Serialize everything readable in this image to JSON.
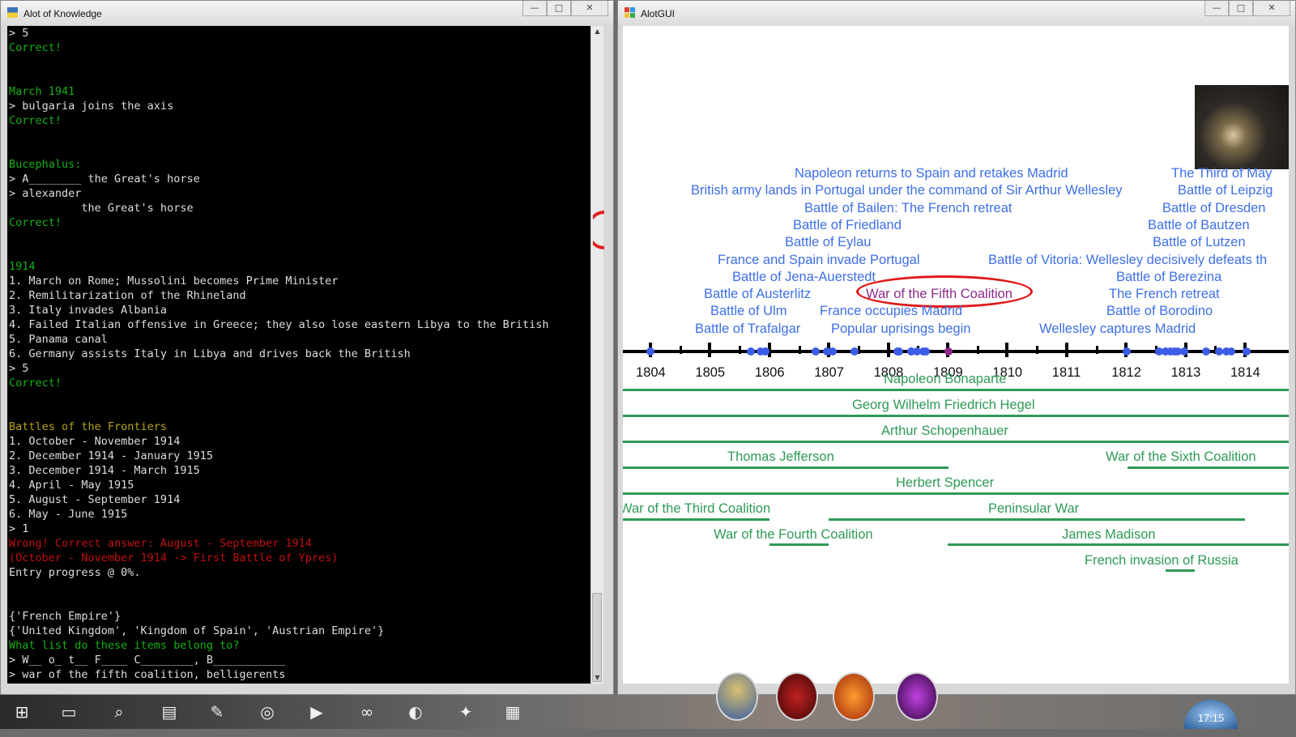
{
  "console_window": {
    "title": "Alot of Knowledge",
    "lines": [
      {
        "text": "> 5",
        "color": "white"
      },
      {
        "text": "Correct!",
        "color": "green"
      },
      {
        "text": "",
        "color": "white"
      },
      {
        "text": "",
        "color": "white"
      },
      {
        "text": "March 1941",
        "color": "green"
      },
      {
        "text": "> bulgaria joins the axis",
        "color": "white"
      },
      {
        "text": "Correct!",
        "color": "green"
      },
      {
        "text": "",
        "color": "white"
      },
      {
        "text": "",
        "color": "white"
      },
      {
        "text": "Bucephalus:",
        "color": "green"
      },
      {
        "text": "> A________ the Great's horse",
        "color": "white"
      },
      {
        "text": "> alexander",
        "color": "white"
      },
      {
        "text": "           the Great's horse",
        "color": "white"
      },
      {
        "text": "Correct!",
        "color": "green"
      },
      {
        "text": "",
        "color": "white"
      },
      {
        "text": "",
        "color": "white"
      },
      {
        "text": "1914",
        "color": "green"
      },
      {
        "text": "1. March on Rome; Mussolini becomes Prime Minister",
        "color": "white"
      },
      {
        "text": "2. Remilitarization of the Rhineland",
        "color": "white"
      },
      {
        "text": "3. Italy invades Albania",
        "color": "white"
      },
      {
        "text": "4. Failed Italian offensive in Greece; they also lose eastern Libya to the British",
        "color": "white"
      },
      {
        "text": "5. Panama canal",
        "color": "white"
      },
      {
        "text": "6. Germany assists Italy in Libya and drives back the British",
        "color": "white"
      },
      {
        "text": "> 5",
        "color": "white"
      },
      {
        "text": "Correct!",
        "color": "green"
      },
      {
        "text": "",
        "color": "white"
      },
      {
        "text": "",
        "color": "white"
      },
      {
        "text": "Battles of the Frontiers",
        "color": "olive"
      },
      {
        "text": "1. October - November 1914",
        "color": "white"
      },
      {
        "text": "2. December 1914 - January 1915",
        "color": "white"
      },
      {
        "text": "3. December 1914 - March 1915",
        "color": "white"
      },
      {
        "text": "4. April - May 1915",
        "color": "white"
      },
      {
        "text": "5. August - September 1914",
        "color": "white"
      },
      {
        "text": "6. May - June 1915",
        "color": "white"
      },
      {
        "text": "> 1",
        "color": "white"
      },
      {
        "text": "Wrong! Correct answer: August - September 1914",
        "color": "red"
      },
      {
        "text": "(October - November 1914 -> First Battle of Ypres)",
        "color": "red"
      },
      {
        "text": "Entry progress @ 0%.",
        "color": "white"
      },
      {
        "text": "",
        "color": "white"
      },
      {
        "text": "",
        "color": "white"
      },
      {
        "text": "{'French Empire'}",
        "color": "white"
      },
      {
        "text": "{'United Kingdom', 'Kingdom of Spain', 'Austrian Empire'}",
        "color": "white"
      },
      {
        "text": "What list do these items belong to?",
        "color": "green"
      },
      {
        "text": "> W__ o_ t__ F____ C________, B___________",
        "color": "white"
      },
      {
        "text": "> war of the fifth coalition, belligerents",
        "color": "white"
      }
    ],
    "colors": {
      "white": "#dedede",
      "green": "#15b015",
      "olive": "#b7a219",
      "red": "#c01010"
    }
  },
  "gui_window": {
    "title": "AlotGUI",
    "events": [
      {
        "label": "Napoleon returns to Spain and retakes Madrid",
        "selected": false
      },
      {
        "label": "British army lands in Portugal under the command of Sir Arthur Wellesley",
        "selected": false
      },
      {
        "label": "Battle of Bailen: The French retreat",
        "selected": false
      },
      {
        "label": "Battle of Friedland",
        "selected": false
      },
      {
        "label": "Battle of Eylau",
        "selected": false
      },
      {
        "label": "France and Spain invade Portugal",
        "selected": false
      },
      {
        "label": "Battle of Jena-Auerstedt",
        "selected": false
      },
      {
        "label": "Battle of Austerlitz",
        "selected": false
      },
      {
        "label": "War of the Fifth Coalition",
        "selected": true
      },
      {
        "label": "Battle of Ulm",
        "selected": false
      },
      {
        "label": "France occupies Madrid",
        "selected": false
      },
      {
        "label": "Battle of Trafalgar",
        "selected": false
      },
      {
        "label": "Popular uprisings begin",
        "selected": false
      },
      {
        "label": "The Third of May",
        "selected": false
      },
      {
        "label": "Battle of Leipzig",
        "selected": false
      },
      {
        "label": "Battle of Dresden",
        "selected": false
      },
      {
        "label": "Battle of Bautzen",
        "selected": false
      },
      {
        "label": "Battle of Lutzen",
        "selected": false
      },
      {
        "label": "Battle of Vitoria: Wellesley decisively defeats th",
        "selected": false
      },
      {
        "label": "Battle of Berezina",
        "selected": false
      },
      {
        "label": "The French retreat",
        "selected": false
      },
      {
        "label": "Battle of Borodino",
        "selected": false
      },
      {
        "label": "Wellesley captures Madrid",
        "selected": false
      }
    ],
    "years": [
      "1804",
      "1805",
      "1806",
      "1807",
      "1808",
      "1809",
      "1810",
      "1811",
      "1812",
      "1813",
      "1814"
    ],
    "spans": [
      {
        "label": "Napoleon Bonaparte"
      },
      {
        "label": "Georg Wilhelm Friedrich Hegel"
      },
      {
        "label": "Arthur Schopenhauer"
      },
      {
        "label": "Thomas Jefferson"
      },
      {
        "label": "War of the Sixth Coalition"
      },
      {
        "label": "Herbert Spencer"
      },
      {
        "label": "War of the Third Coalition"
      },
      {
        "label": "Peninsular War"
      },
      {
        "label": "War of the Fourth Coalition"
      },
      {
        "label": "James Madison"
      },
      {
        "label": "French invasion of Russia"
      }
    ],
    "colors": {
      "event": "#3d6fe6",
      "selected_event": "#8b2a8b",
      "highlight_ring": "#e01818",
      "span": "#2e9a55",
      "axis": "#000000"
    }
  },
  "taskbar": {
    "clock": "17:15",
    "icons": [
      "windows-start-icon",
      "desktop-icon",
      "search-icon",
      "document-icon",
      "pen-icon",
      "chrome-icon",
      "play-icon",
      "network-icon",
      "browser-swirl-icon",
      "python-icon",
      "control-panel-icon"
    ]
  }
}
